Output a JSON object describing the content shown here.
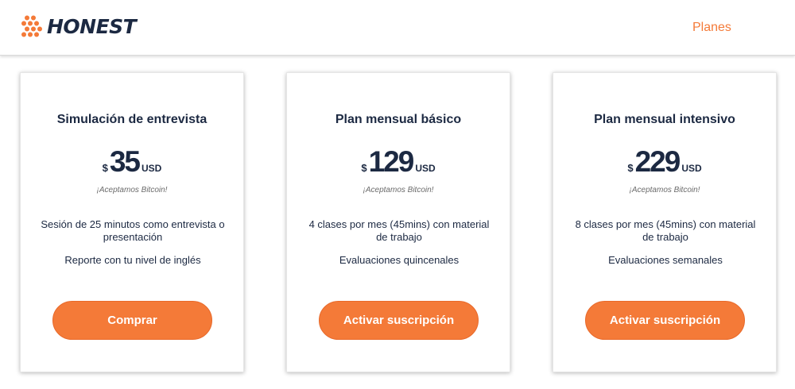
{
  "header": {
    "logo_text": "HONEST",
    "nav_link": "Planes"
  },
  "colors": {
    "accent": "#f47a38",
    "text_dark": "#1c2942",
    "note_gray": "#6b6b6b"
  },
  "icons": {
    "logo": "honeycomb-dots-logo"
  },
  "plans": [
    {
      "title": "Simulación de entrevista",
      "currency": "$",
      "amount": "35",
      "unit": "USD",
      "note": "¡Aceptamos Bitcoin!",
      "feature_1": "Sesión de 25 minutos como entrevista o presentación",
      "feature_2": "Reporte con tu nivel de inglés",
      "button": "Comprar"
    },
    {
      "title": "Plan mensual básico",
      "currency": "$",
      "amount": "129",
      "unit": "USD",
      "note": "¡Aceptamos Bitcoin!",
      "feature_1": "4 clases por mes (45mins) con material de trabajo",
      "feature_2": "Evaluaciones quincenales",
      "button": "Activar suscripción"
    },
    {
      "title": "Plan mensual intensivo",
      "currency": "$",
      "amount": "229",
      "unit": "USD",
      "note": "¡Aceptamos Bitcoin!",
      "feature_1": "8 clases por mes (45mins) con material de trabajo",
      "feature_2": "Evaluaciones semanales",
      "button": "Activar suscripción"
    }
  ]
}
